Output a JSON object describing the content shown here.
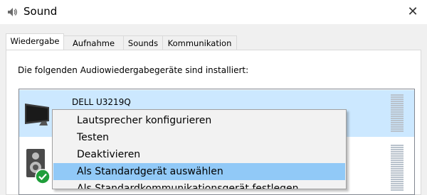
{
  "window": {
    "title": "Sound",
    "close_glyph": "✕",
    "app_icon": "speaker-icon"
  },
  "tabs": [
    {
      "label": "Wiedergabe",
      "active": true
    },
    {
      "label": "Aufnahme",
      "active": false
    },
    {
      "label": "Sounds",
      "active": false
    },
    {
      "label": "Kommunikation",
      "active": false
    }
  ],
  "panel": {
    "instruction": "Die folgenden Audiowiedergabegeräte sind installiert:"
  },
  "devices": [
    {
      "name": "DELL U3219Q",
      "icon": "monitor-icon",
      "selected": true
    },
    {
      "name": "",
      "icon": "speaker-icon",
      "default_check": true,
      "selected": false
    }
  ],
  "context_menu": {
    "items": [
      {
        "label": "Lautsprecher konfigurieren",
        "highlighted": false
      },
      {
        "label": "Testen",
        "highlighted": false
      },
      {
        "label": "Deaktivieren",
        "highlighted": false
      },
      {
        "label": "Als Standardgerät auswählen",
        "highlighted": true
      },
      {
        "label": "Als Standardkommunikationsgerät festlegen",
        "highlighted": false
      }
    ]
  },
  "colors": {
    "selection": "#cce8ff",
    "menu_highlight": "#91c9f7",
    "check_badge": "#1f9e3a"
  }
}
